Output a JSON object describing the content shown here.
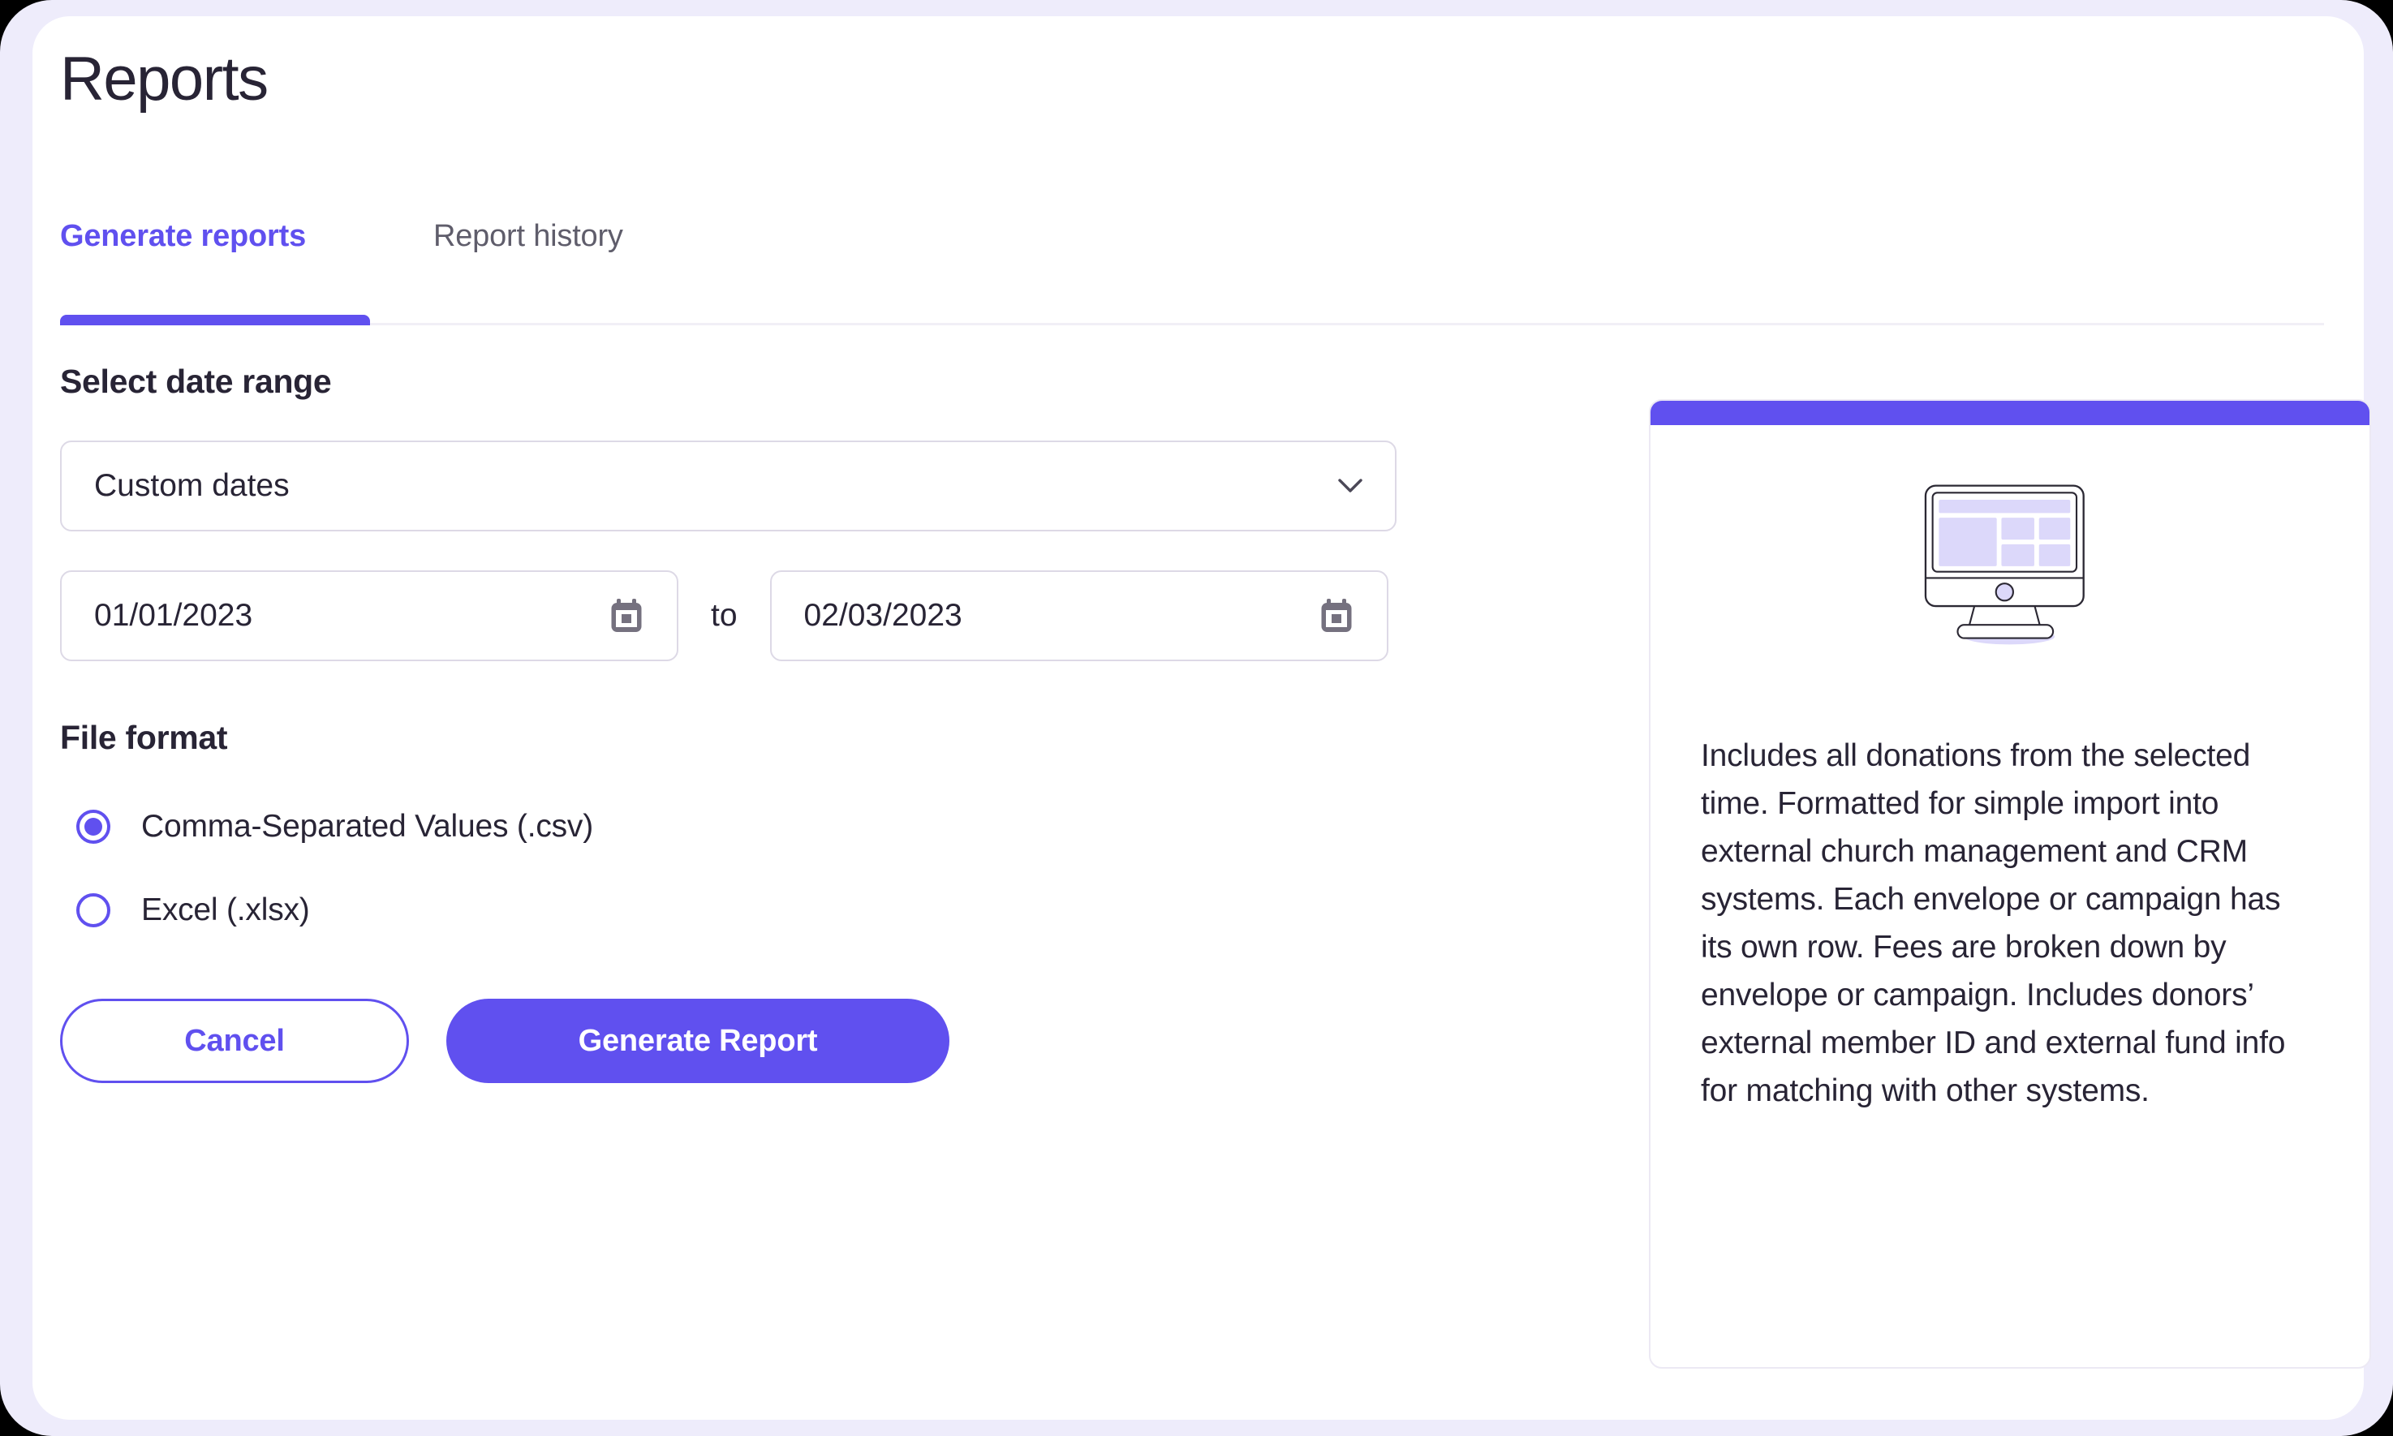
{
  "page": {
    "title": "Reports"
  },
  "tabs": [
    {
      "label": "Generate reports",
      "active": true
    },
    {
      "label": "Report history",
      "active": false
    }
  ],
  "form": {
    "date_range_label": "Select date range",
    "range_preset": {
      "value": "Custom dates",
      "icon": "chevron-down-icon"
    },
    "start_date": {
      "value": "01/01/2023",
      "icon": "calendar-icon"
    },
    "separator_label": "to",
    "end_date": {
      "value": "02/03/2023",
      "icon": "calendar-icon"
    },
    "file_format_label": "File format",
    "file_format_options": [
      {
        "label": "Comma-Separated Values (.csv)",
        "selected": true
      },
      {
        "label": "Excel (.xlsx)",
        "selected": false
      }
    ],
    "cancel_label": "Cancel",
    "generate_label": "Generate Report"
  },
  "info_card": {
    "illustration": "desktop-monitor-icon",
    "description": "Includes all donations from the selected time. Formatted for simple import into external church management and CRM systems. Each envelope or campaign has its own row. Fees are broken down by envelope or campaign. Includes donors’ external member ID and external fund info for matching with other systems."
  },
  "colors": {
    "accent": "#6050ef",
    "text": "#282435",
    "muted_text": "#5f5d6b",
    "border": "#ddd9e6",
    "page_background": "#eeecfb",
    "illustration_fill": "#dcd8fa"
  }
}
